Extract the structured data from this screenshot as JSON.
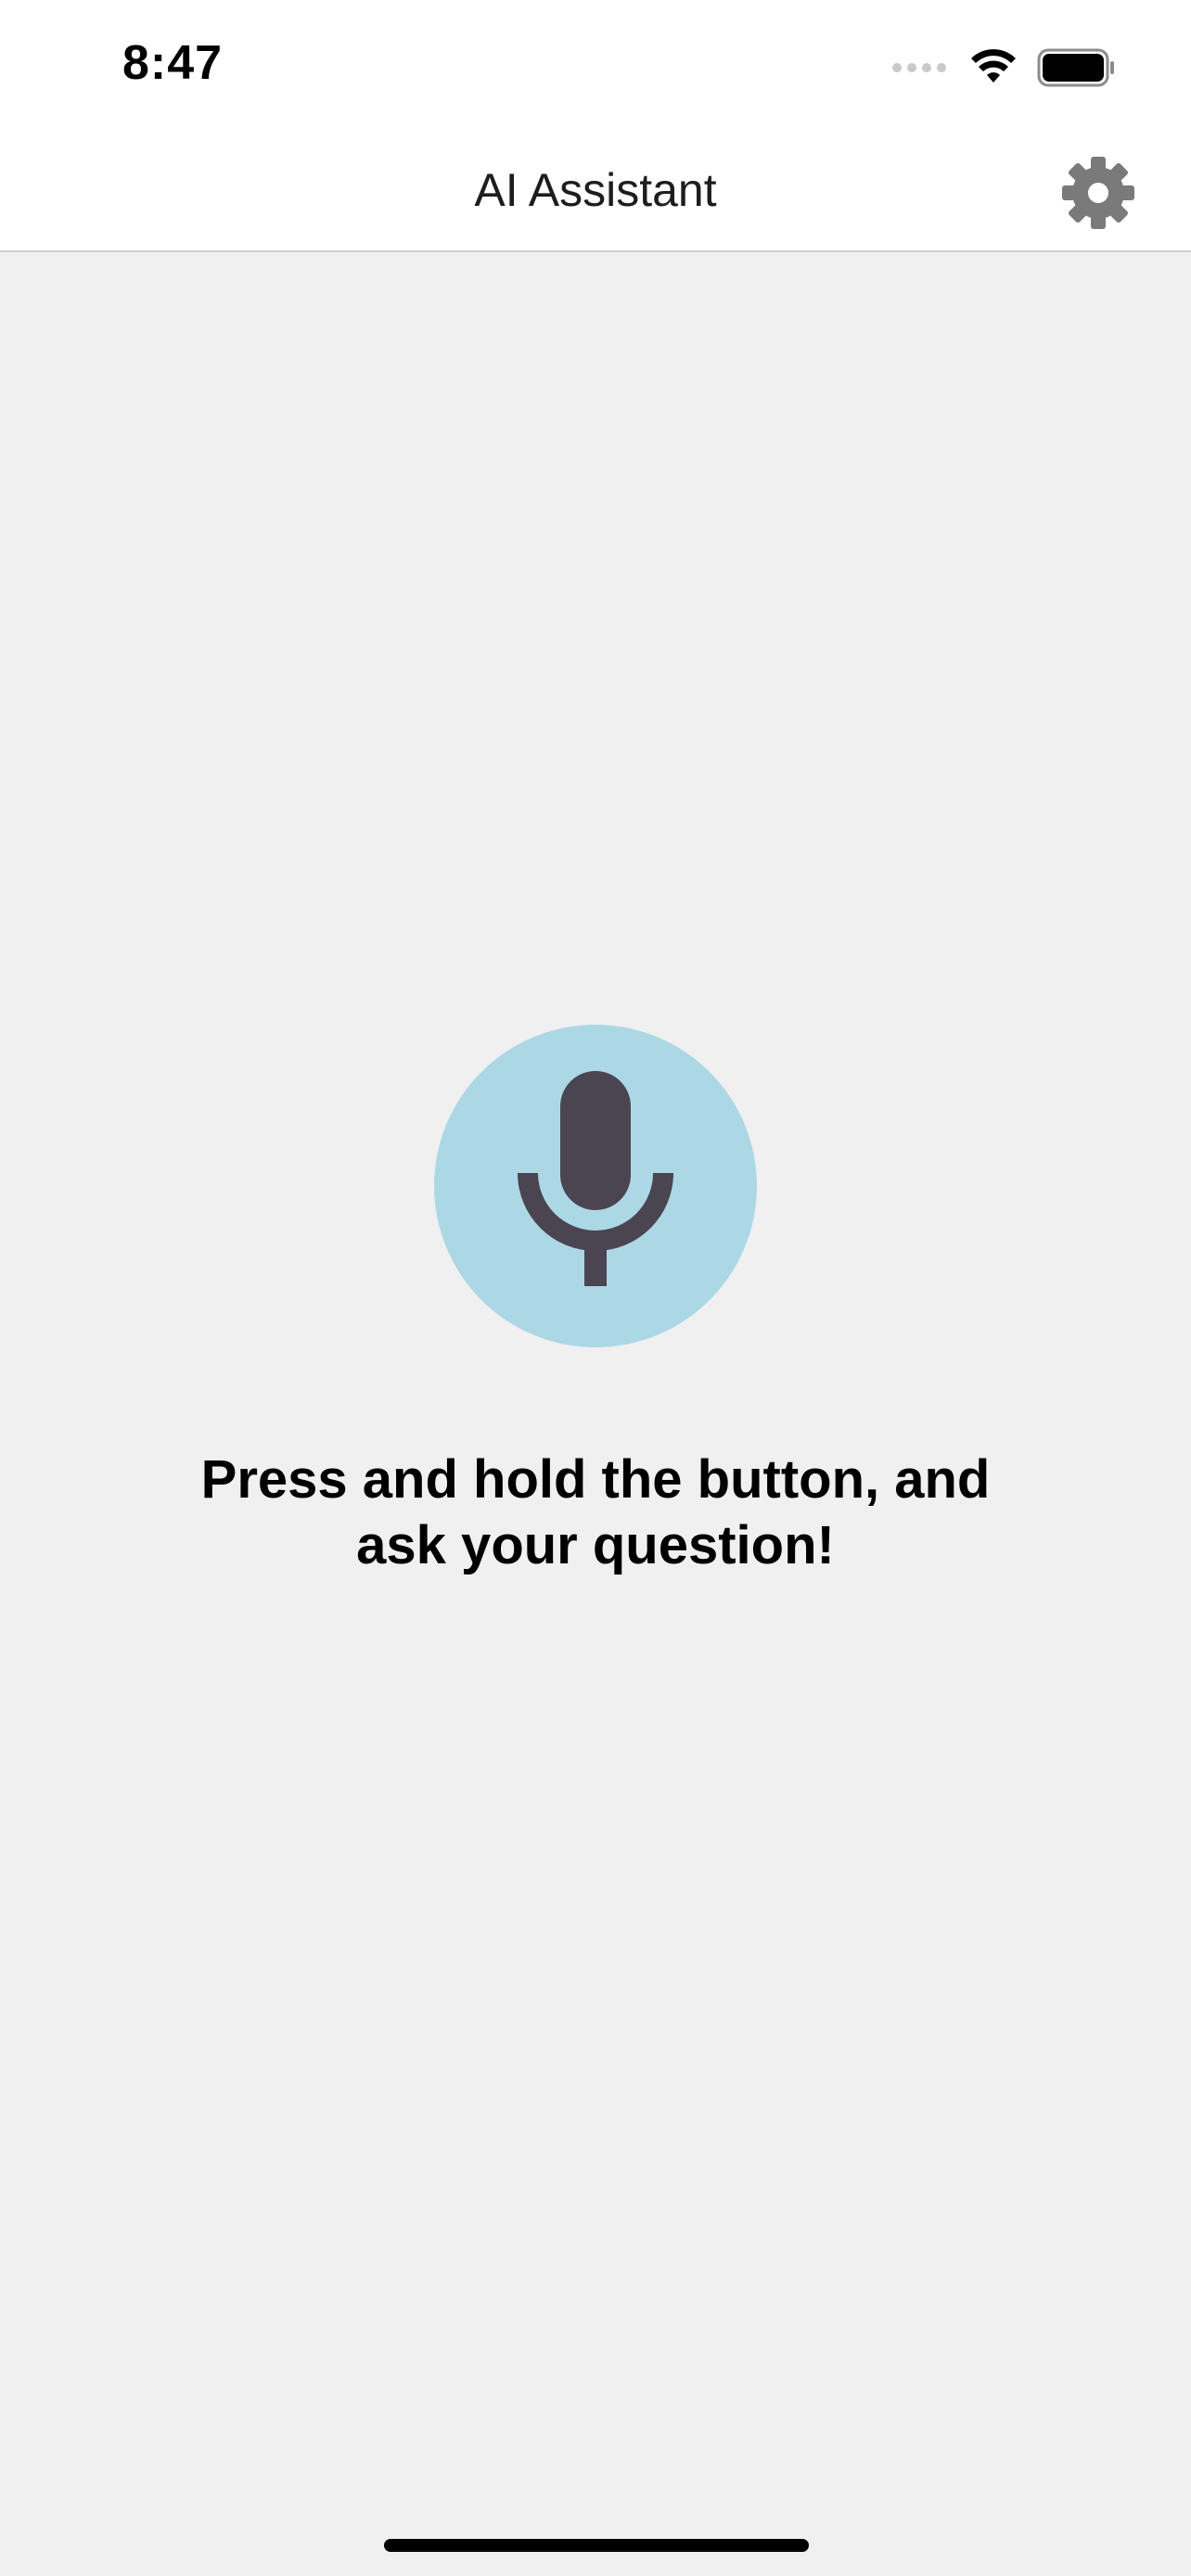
{
  "status_bar": {
    "time": "8:47",
    "icons": [
      "signal-icon",
      "wifi-icon",
      "battery-icon"
    ]
  },
  "nav": {
    "title": "AI Assistant",
    "settings_icon": "gear-icon"
  },
  "main": {
    "mic_icon": "microphone-icon",
    "prompt_line1": "Press and hold the button, and",
    "prompt_line2": "ask your question!"
  },
  "colors": {
    "background": "#f0f0f0",
    "mic_circle": "#acd8e6",
    "mic_glyph": "#4a4550",
    "gear": "#7a7a7a"
  }
}
